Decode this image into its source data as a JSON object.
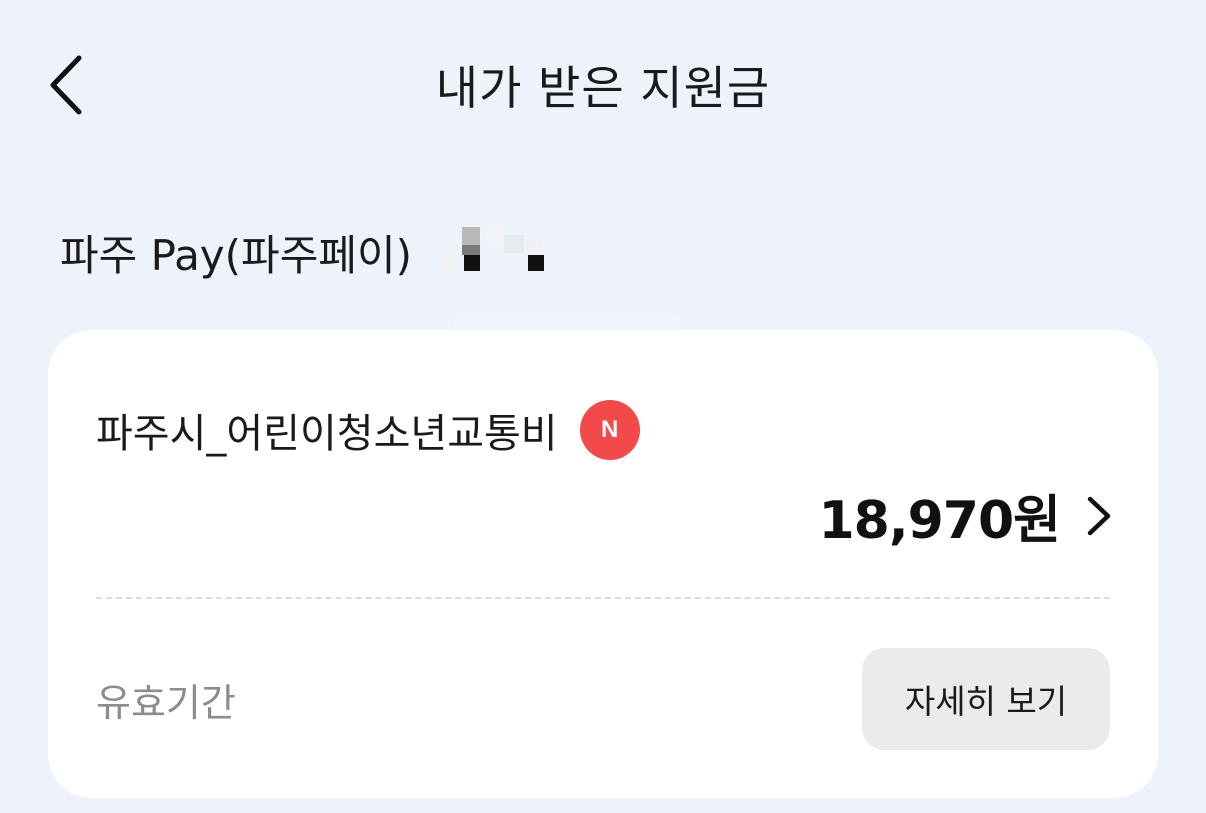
{
  "header": {
    "title": "내가 받은 지원금",
    "back_icon": "chevron-left-icon"
  },
  "section": {
    "title": "파주 Pay(파주페이)"
  },
  "benefit": {
    "name": "파주시_어린이청소년교통비",
    "badge": "N",
    "amount": "18,970원",
    "validity_label": "유효기간",
    "detail_button": "자세히 보기"
  },
  "colors": {
    "background": "#eef2fa",
    "card": "#ffffff",
    "badge": "#f24a4a",
    "button": "#ebebeb"
  }
}
